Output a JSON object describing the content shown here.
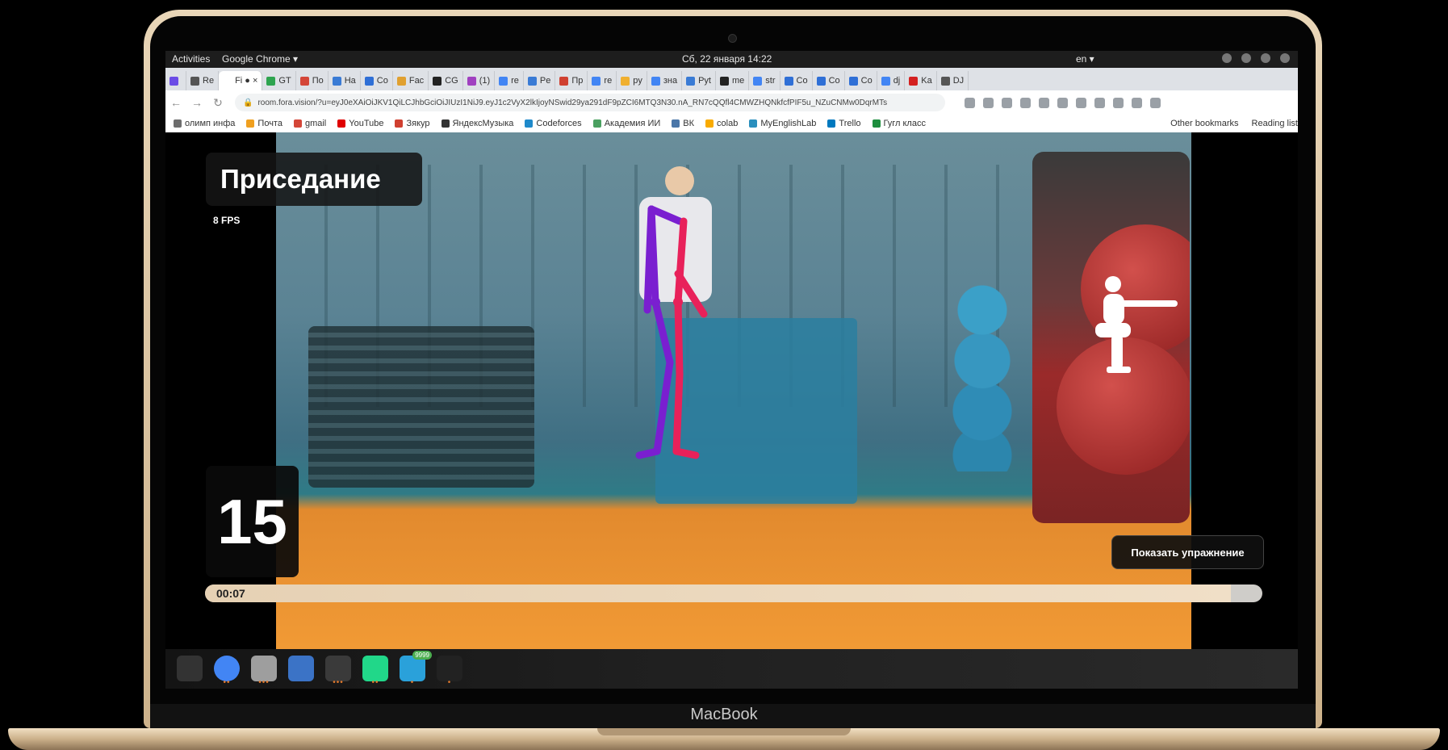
{
  "topbar": {
    "activities": "Activities",
    "app": "Google Chrome ▾",
    "clock": "Сб, 22 января  14:22",
    "lang": "en ▾"
  },
  "browser": {
    "tabs": [
      {
        "label": "",
        "color": "#6b4ce6"
      },
      {
        "label": "Re",
        "color": "#555555"
      },
      {
        "label": "Fi ● ×",
        "color": "#ffffff",
        "active": true
      },
      {
        "label": "GT",
        "color": "#2ea44f"
      },
      {
        "label": "По",
        "color": "#d44638"
      },
      {
        "label": "На",
        "color": "#3a7bd5"
      },
      {
        "label": "Co",
        "color": "#2f6fd6"
      },
      {
        "label": "Fac",
        "color": "#e0a030"
      },
      {
        "label": "CG",
        "color": "#222222"
      },
      {
        "label": "(1)",
        "color": "#a040c0"
      },
      {
        "label": "re",
        "color": "#4285f4"
      },
      {
        "label": "Pe",
        "color": "#3a7bd5"
      },
      {
        "label": "Пр",
        "color": "#d04030"
      },
      {
        "label": "re",
        "color": "#4285f4"
      },
      {
        "label": "py",
        "color": "#f0b030"
      },
      {
        "label": "зна",
        "color": "#4285f4"
      },
      {
        "label": "Pyt",
        "color": "#3a7bd5"
      },
      {
        "label": "me",
        "color": "#222222"
      },
      {
        "label": "str",
        "color": "#4285f4"
      },
      {
        "label": "Co",
        "color": "#2f6fd6"
      },
      {
        "label": "Co",
        "color": "#2f6fd6"
      },
      {
        "label": "Co",
        "color": "#2f6fd6"
      },
      {
        "label": "dj",
        "color": "#4285f4"
      },
      {
        "label": "Ka",
        "color": "#d42020"
      },
      {
        "label": "DJ",
        "color": "#555555"
      }
    ],
    "url": "room.fora.vision/?u=eyJ0eXAiOiJKV1QiLCJhbGciOiJIUzI1NiJ9.eyJ1c2VyX2lkIjoyNSwid29ya291dF9pZCI6MTQ3N30.nA_RN7cQQfl4CMWZHQNkfcfPIF5u_NZuCNMw0DqrMTs",
    "bookmarks": [
      {
        "label": "олимп инфа",
        "color": "#6d6d6d"
      },
      {
        "label": "Почта",
        "color": "#f0a020"
      },
      {
        "label": "gmail",
        "color": "#d44638"
      },
      {
        "label": "YouTube",
        "color": "#e00000"
      },
      {
        "label": "Зякур",
        "color": "#d04030"
      },
      {
        "label": "ЯндексМузыка",
        "color": "#333333"
      },
      {
        "label": "Codeforces",
        "color": "#1f8acb"
      },
      {
        "label": "Академия ИИ",
        "color": "#4aa060"
      },
      {
        "label": "ВК",
        "color": "#4a76a8"
      },
      {
        "label": "colab",
        "color": "#f9ab00"
      },
      {
        "label": "MyEnglishLab",
        "color": "#2a8fbd"
      },
      {
        "label": "Trello",
        "color": "#0079bf"
      },
      {
        "label": "Гугл класс",
        "color": "#1e8e3e"
      }
    ],
    "other_bookmarks": "Other bookmarks",
    "reading_list": "Reading list"
  },
  "app": {
    "exercise_title": "Приседание",
    "fps": "8 FPS",
    "rep_count": "15",
    "show_exercise": "Показать упражнение",
    "timer": "00:07",
    "progress_fraction": 0.97
  },
  "dock": {
    "items": [
      {
        "name": "apps-grid-icon",
        "color": "#333333",
        "dots": ""
      },
      {
        "name": "chrome-icon",
        "color": "#4285f4",
        "dots": "••"
      },
      {
        "name": "files-icon",
        "color": "#9e9e9e",
        "dots": "•••"
      },
      {
        "name": "document-icon",
        "color": "#3b73c6",
        "dots": ""
      },
      {
        "name": "terminal-icon",
        "color": "#3a3a3a",
        "dots": "•••"
      },
      {
        "name": "pycharm-icon",
        "color": "#21d789",
        "dots": "••"
      },
      {
        "name": "telegram-icon",
        "color": "#2aa1da",
        "dots": "•",
        "badge": "9999"
      },
      {
        "name": "obs-icon",
        "color": "#222222",
        "dots": "•"
      }
    ]
  },
  "device": {
    "brand": "MacBook"
  }
}
